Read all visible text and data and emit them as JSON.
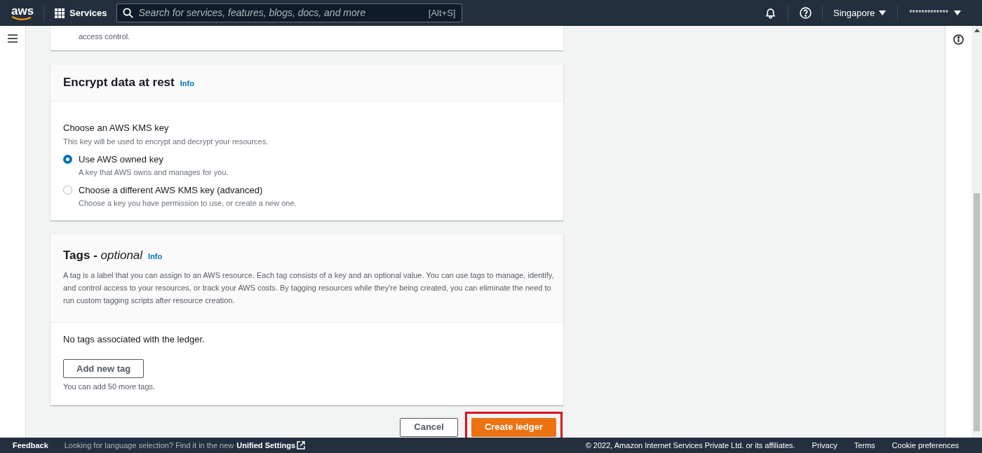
{
  "top_nav": {
    "logo": "aws",
    "services": "Services",
    "search": {
      "placeholder": "Search for services, features, blogs, docs, and more",
      "shortcut": "[Alt+S]"
    },
    "region": "Singapore",
    "account": "*************"
  },
  "previous_section": {
    "text_tail": "access control."
  },
  "encryption": {
    "title": "Encrypt data at rest",
    "info": "Info",
    "field_label": "Choose an AWS KMS key",
    "field_description": "This key will be used to encrypt and decrypt your resources.",
    "options": [
      {
        "label": "Use AWS owned key",
        "description": "A key that AWS owns and manages for you.",
        "selected": true
      },
      {
        "label": "Choose a different AWS KMS key (advanced)",
        "description": "Choose a key you have permission to use, or create a new one.",
        "selected": false
      }
    ]
  },
  "tags": {
    "title": "Tags - ",
    "title_emphasis": "optional",
    "info": "Info",
    "description": "A tag is a label that you can assign to an AWS resource. Each tag consists of a key and an optional value. You can use tags to manage, identify, and control access to your resources, or track your AWS costs. By tagging resources while they're being created, you can eliminate the need to run custom tagging scripts after resource creation.",
    "empty": "No tags associated with the ledger.",
    "add_button": "Add new tag",
    "limit": "You can add 50 more tags."
  },
  "actions": {
    "cancel": "Cancel",
    "submit": "Create ledger",
    "submit_highlighted": true
  },
  "footer": {
    "feedback": "Feedback",
    "language_note": "Looking for language selection? Find it in the new",
    "unified_settings": "Unified Settings",
    "copyright": "© 2022, Amazon Internet Services Private Ltd. or its affiliates.",
    "links": [
      "Privacy",
      "Terms",
      "Cookie preferences"
    ]
  }
}
